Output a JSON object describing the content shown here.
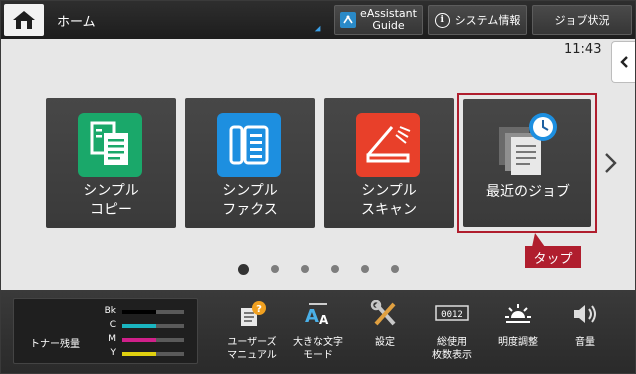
{
  "topbar": {
    "title": "ホーム",
    "eassistant_line1": "eAssistant",
    "eassistant_line2": "Guide",
    "system_info_label": "システム情報",
    "job_status_label": "ジョブ状況"
  },
  "clock": "11:43",
  "tiles": [
    {
      "line1": "シンプル",
      "line2": "コピー",
      "icon": "copy-icon",
      "color": "#1aa86a"
    },
    {
      "line1": "シンプル",
      "line2": "ファクス",
      "icon": "fax-icon",
      "color": "#1d8fe0"
    },
    {
      "line1": "シンプル",
      "line2": "スキャン",
      "icon": "scan-icon",
      "color": "#e8402a"
    },
    {
      "line1": "最近のジョブ",
      "line2": "",
      "icon": "recent-jobs-icon",
      "color": "#5c5c5c"
    }
  ],
  "callout": {
    "label": "タップ",
    "color": "#b01e2e"
  },
  "pager": {
    "pages": 6,
    "active": 1
  },
  "toner": {
    "label": "トナー残量",
    "levels": [
      {
        "name": "Bk",
        "color": "#000000",
        "level": 0.55
      },
      {
        "name": "C",
        "color": "#1ab5c0",
        "level": 0.55
      },
      {
        "name": "M",
        "color": "#d0208a",
        "level": 0.55
      },
      {
        "name": "Y",
        "color": "#e0d010",
        "level": 0.55
      }
    ]
  },
  "bottom": {
    "user_manual_line1": "ユーザーズ",
    "user_manual_line2": "マニュアル",
    "large_text_line1": "大きな文字",
    "large_text_line2": "モード",
    "settings": "設定",
    "usage_line1": "総使用",
    "usage_line2": "枚数表示",
    "usage_counter": "0012",
    "brightness": "明度調整",
    "volume": "音量"
  }
}
